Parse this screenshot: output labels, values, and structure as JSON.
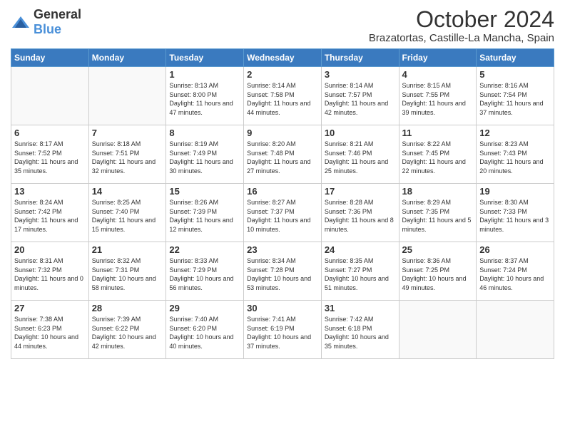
{
  "logo": {
    "general": "General",
    "blue": "Blue"
  },
  "header": {
    "month": "October 2024",
    "location": "Brazatortas, Castille-La Mancha, Spain"
  },
  "weekdays": [
    "Sunday",
    "Monday",
    "Tuesday",
    "Wednesday",
    "Thursday",
    "Friday",
    "Saturday"
  ],
  "weeks": [
    [
      {
        "day": "",
        "info": ""
      },
      {
        "day": "",
        "info": ""
      },
      {
        "day": "1",
        "info": "Sunrise: 8:13 AM\nSunset: 8:00 PM\nDaylight: 11 hours and 47 minutes."
      },
      {
        "day": "2",
        "info": "Sunrise: 8:14 AM\nSunset: 7:58 PM\nDaylight: 11 hours and 44 minutes."
      },
      {
        "day": "3",
        "info": "Sunrise: 8:14 AM\nSunset: 7:57 PM\nDaylight: 11 hours and 42 minutes."
      },
      {
        "day": "4",
        "info": "Sunrise: 8:15 AM\nSunset: 7:55 PM\nDaylight: 11 hours and 39 minutes."
      },
      {
        "day": "5",
        "info": "Sunrise: 8:16 AM\nSunset: 7:54 PM\nDaylight: 11 hours and 37 minutes."
      }
    ],
    [
      {
        "day": "6",
        "info": "Sunrise: 8:17 AM\nSunset: 7:52 PM\nDaylight: 11 hours and 35 minutes."
      },
      {
        "day": "7",
        "info": "Sunrise: 8:18 AM\nSunset: 7:51 PM\nDaylight: 11 hours and 32 minutes."
      },
      {
        "day": "8",
        "info": "Sunrise: 8:19 AM\nSunset: 7:49 PM\nDaylight: 11 hours and 30 minutes."
      },
      {
        "day": "9",
        "info": "Sunrise: 8:20 AM\nSunset: 7:48 PM\nDaylight: 11 hours and 27 minutes."
      },
      {
        "day": "10",
        "info": "Sunrise: 8:21 AM\nSunset: 7:46 PM\nDaylight: 11 hours and 25 minutes."
      },
      {
        "day": "11",
        "info": "Sunrise: 8:22 AM\nSunset: 7:45 PM\nDaylight: 11 hours and 22 minutes."
      },
      {
        "day": "12",
        "info": "Sunrise: 8:23 AM\nSunset: 7:43 PM\nDaylight: 11 hours and 20 minutes."
      }
    ],
    [
      {
        "day": "13",
        "info": "Sunrise: 8:24 AM\nSunset: 7:42 PM\nDaylight: 11 hours and 17 minutes."
      },
      {
        "day": "14",
        "info": "Sunrise: 8:25 AM\nSunset: 7:40 PM\nDaylight: 11 hours and 15 minutes."
      },
      {
        "day": "15",
        "info": "Sunrise: 8:26 AM\nSunset: 7:39 PM\nDaylight: 11 hours and 12 minutes."
      },
      {
        "day": "16",
        "info": "Sunrise: 8:27 AM\nSunset: 7:37 PM\nDaylight: 11 hours and 10 minutes."
      },
      {
        "day": "17",
        "info": "Sunrise: 8:28 AM\nSunset: 7:36 PM\nDaylight: 11 hours and 8 minutes."
      },
      {
        "day": "18",
        "info": "Sunrise: 8:29 AM\nSunset: 7:35 PM\nDaylight: 11 hours and 5 minutes."
      },
      {
        "day": "19",
        "info": "Sunrise: 8:30 AM\nSunset: 7:33 PM\nDaylight: 11 hours and 3 minutes."
      }
    ],
    [
      {
        "day": "20",
        "info": "Sunrise: 8:31 AM\nSunset: 7:32 PM\nDaylight: 11 hours and 0 minutes."
      },
      {
        "day": "21",
        "info": "Sunrise: 8:32 AM\nSunset: 7:31 PM\nDaylight: 10 hours and 58 minutes."
      },
      {
        "day": "22",
        "info": "Sunrise: 8:33 AM\nSunset: 7:29 PM\nDaylight: 10 hours and 56 minutes."
      },
      {
        "day": "23",
        "info": "Sunrise: 8:34 AM\nSunset: 7:28 PM\nDaylight: 10 hours and 53 minutes."
      },
      {
        "day": "24",
        "info": "Sunrise: 8:35 AM\nSunset: 7:27 PM\nDaylight: 10 hours and 51 minutes."
      },
      {
        "day": "25",
        "info": "Sunrise: 8:36 AM\nSunset: 7:25 PM\nDaylight: 10 hours and 49 minutes."
      },
      {
        "day": "26",
        "info": "Sunrise: 8:37 AM\nSunset: 7:24 PM\nDaylight: 10 hours and 46 minutes."
      }
    ],
    [
      {
        "day": "27",
        "info": "Sunrise: 7:38 AM\nSunset: 6:23 PM\nDaylight: 10 hours and 44 minutes."
      },
      {
        "day": "28",
        "info": "Sunrise: 7:39 AM\nSunset: 6:22 PM\nDaylight: 10 hours and 42 minutes."
      },
      {
        "day": "29",
        "info": "Sunrise: 7:40 AM\nSunset: 6:20 PM\nDaylight: 10 hours and 40 minutes."
      },
      {
        "day": "30",
        "info": "Sunrise: 7:41 AM\nSunset: 6:19 PM\nDaylight: 10 hours and 37 minutes."
      },
      {
        "day": "31",
        "info": "Sunrise: 7:42 AM\nSunset: 6:18 PM\nDaylight: 10 hours and 35 minutes."
      },
      {
        "day": "",
        "info": ""
      },
      {
        "day": "",
        "info": ""
      }
    ]
  ]
}
